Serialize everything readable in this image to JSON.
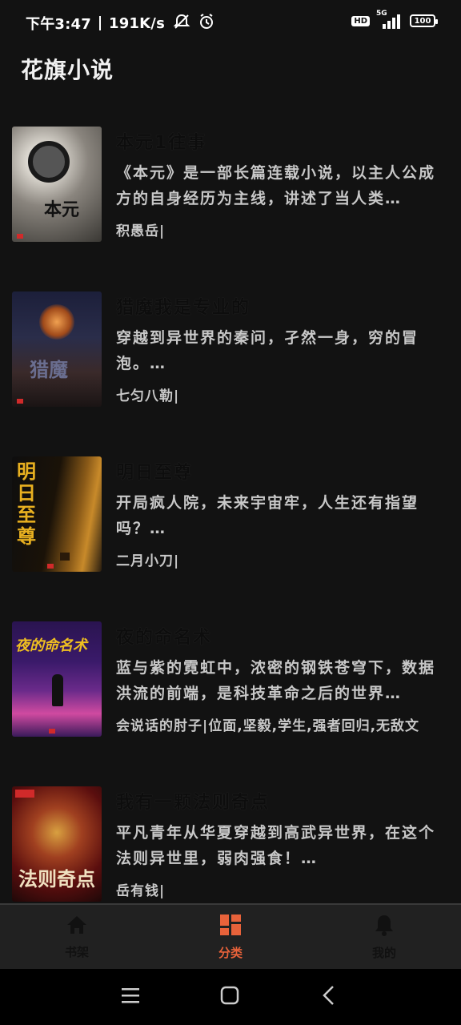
{
  "status_bar": {
    "time": "下午3:47",
    "speed": "191K/s",
    "hd": "HD",
    "network": "5G",
    "battery": "100"
  },
  "app": {
    "title": "花旗小说"
  },
  "books": [
    {
      "title": "本元1往事",
      "description": "《本元》是一部长篇连载小说，以主人公成方的自身经历为主线，讲述了当人类…",
      "meta": "积愚岳|",
      "cover_text": "本元",
      "cover_colors": [
        "#d8d4cc",
        "#6b6660"
      ]
    },
    {
      "title": "猎魔我是专业的",
      "description": "穿越到异世界的秦问，孑然一身，穷的冒泡。…",
      "meta": "七匀八勒|",
      "cover_text": "猎魔",
      "cover_colors": [
        "#2a2d4a",
        "#8a4a2a"
      ]
    },
    {
      "title": "明日至尊",
      "description": "开局疯人院，未来宇宙牢，人生还有指望吗？…",
      "meta": "二月小刀|",
      "cover_text": "明日至尊",
      "cover_colors": [
        "#0e0e0e",
        "#c88a2a"
      ]
    },
    {
      "title": "夜的命名术",
      "description": "蓝与紫的霓虹中，浓密的钢铁苍穹下，数据洪流的前端，是科技革命之后的世界…",
      "meta": "会说话的肘子|位面,坚毅,学生,强者回归,无敌文",
      "cover_text": "夜的命名术",
      "cover_colors": [
        "#3a1a6a",
        "#d04aa0"
      ]
    },
    {
      "title": "我有一颗法则奇点",
      "description": "平凡青年从华夏穿越到高武异世界，在这个法则异世里，弱肉强食！…",
      "meta": "岳有钱|",
      "cover_text": "法则奇点",
      "cover_colors": [
        "#5a0e0e",
        "#d8a040"
      ]
    }
  ],
  "bottom_nav": [
    {
      "label": "书架",
      "icon": "home-icon",
      "active": false
    },
    {
      "label": "分类",
      "icon": "category-icon",
      "active": true
    },
    {
      "label": "我的",
      "icon": "bell-icon",
      "active": false
    }
  ],
  "colors": {
    "accent": "#e8623a",
    "background": "#121212",
    "nav_bg": "#212121"
  }
}
